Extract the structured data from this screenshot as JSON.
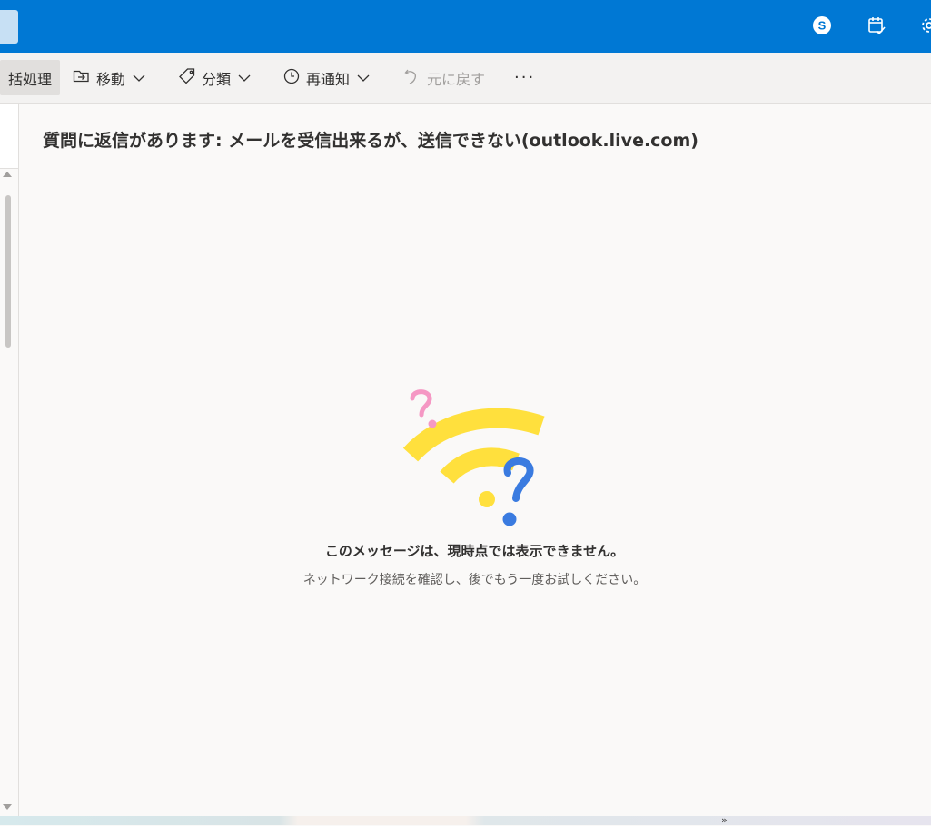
{
  "header": {
    "icons": [
      "skype-icon",
      "calendar-check-icon",
      "gear-icon"
    ]
  },
  "toolbar": {
    "batch_label": "括処理",
    "move_label": "移動",
    "categorize_label": "分類",
    "snooze_label": "再通知",
    "undo_label": "元に戻す",
    "more_label": "···"
  },
  "message": {
    "subject": "質問に返信があります: メールを受信出来るが、送信できない(outlook.live.com)"
  },
  "error": {
    "title": "このメッセージは、現時点では表示できません。",
    "subtitle": "ネットワーク接続を確認し、後でもう一度お試しください。"
  },
  "bottom": {
    "chevron": "»"
  },
  "colors": {
    "brand": "#0078d4",
    "wifi_yellow": "#ffe03d",
    "question_pink": "#f598c4",
    "question_blue": "#3a7be0"
  }
}
